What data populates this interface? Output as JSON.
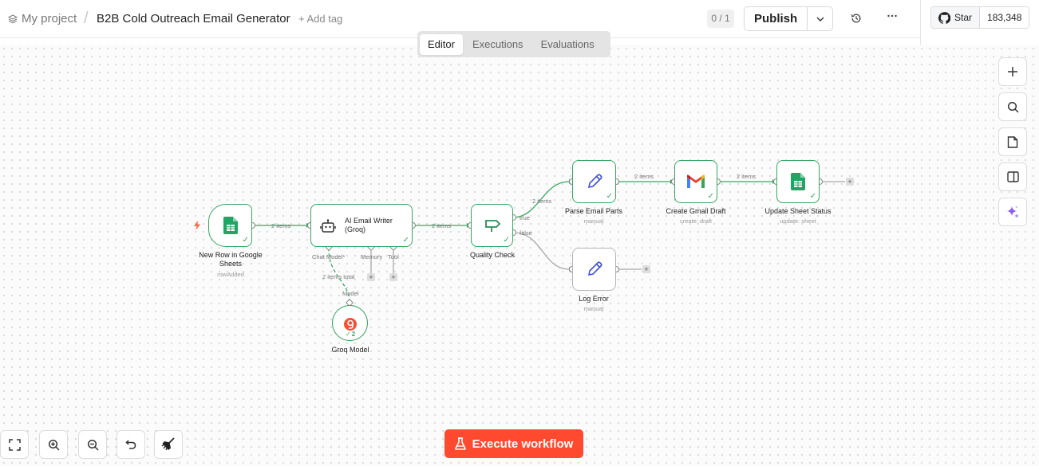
{
  "header": {
    "project_name": "My project",
    "separator": "/",
    "workflow_title": "B2B Cold Outreach Email Generator",
    "add_tag": "+ Add tag",
    "counter": "0 / 1",
    "publish_label": "Publish",
    "github_star_label": "Star",
    "github_star_count": "183,348"
  },
  "tabs": [
    {
      "label": "Editor",
      "active": true
    },
    {
      "label": "Executions",
      "active": false
    },
    {
      "label": "Evaluations",
      "active": false
    }
  ],
  "nodes": {
    "sheets_trigger": {
      "label": "New Row in Google Sheets",
      "sub": "rowAdded"
    },
    "ai_writer": {
      "label": "AI Email Writer (Groq)",
      "port_chat_model": "Chat Model*",
      "port_memory": "Memory",
      "port_tool": "Tool"
    },
    "quality_check": {
      "label": "Quality Check",
      "branch_true": "true",
      "branch_false": "false"
    },
    "parse_email": {
      "label": "Parse Email Parts",
      "sub": "manual"
    },
    "gmail_draft": {
      "label": "Create Gmail Draft",
      "sub": "create: draft"
    },
    "update_sheet": {
      "label": "Update Sheet Status",
      "sub": "update: sheet"
    },
    "log_error": {
      "label": "Log Error",
      "sub": "manual"
    },
    "groq_model": {
      "label": "Groq Model",
      "port_model": "Model",
      "run_count": "2"
    }
  },
  "edge_labels": {
    "trigger_to_ai": "2 items",
    "ai_to_quality": "2 items",
    "quality_to_parse": "2 items",
    "parse_to_gmail": "2 items",
    "gmail_to_update": "2 items",
    "groq_to_ai": "2 items total"
  },
  "execute_button": {
    "label": "Execute workflow"
  },
  "colors": {
    "success": "#3aa664",
    "accent": "#ff4a2f",
    "ai": "#8b5cf6"
  }
}
